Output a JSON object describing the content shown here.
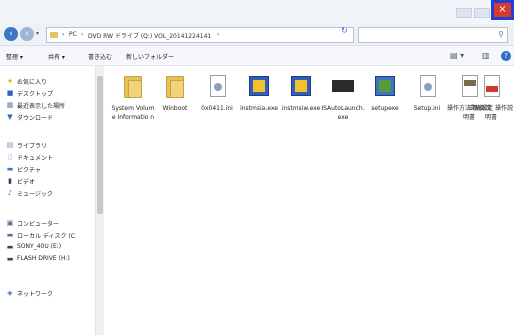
{
  "address": {
    "segments": [
      "PC",
      "DVD RW ドライブ (Q:) VOL_20141224141",
      ""
    ],
    "dropdown_arrow": "▾",
    "refresh": "↻"
  },
  "search": {
    "placeholder": ""
  },
  "toolbar": {
    "organize": "整理 ▾",
    "share": "共有 ▾",
    "burn": "書き込む",
    "new_folder": "新しいフォルダー"
  },
  "sidebar": {
    "items": [
      {
        "label": "お気に入り",
        "icon": "star-icon"
      },
      {
        "label": "デスクトップ",
        "icon": "desktop-icon"
      },
      {
        "label": "最近表示した場所",
        "icon": "recent-places-icon"
      },
      {
        "label": "ダウンロード",
        "icon": "download-icon"
      },
      {
        "label": "ライブラリ",
        "icon": "library-icon"
      },
      {
        "label": "ドキュメント",
        "icon": "documents-icon"
      },
      {
        "label": "ピクチャ",
        "icon": "pictures-icon"
      },
      {
        "label": "ビデオ",
        "icon": "videos-icon"
      },
      {
        "label": "ミュージック",
        "icon": "music-icon"
      },
      {
        "label": "コンピューター",
        "icon": "computer-icon"
      },
      {
        "label": "ローカル ディスク (C",
        "icon": "local-disk-icon"
      },
      {
        "label": "SONY_40U (E:)",
        "icon": "usb-drive-icon"
      },
      {
        "label": "FLASH DRIVE (H:)",
        "icon": "flash-drive-icon"
      },
      {
        "label": "ネットワーク",
        "icon": "network-icon"
      }
    ]
  },
  "files": [
    {
      "name": "System Volume Informatio n",
      "type": "folder"
    },
    {
      "name": "Winboot",
      "type": "folder"
    },
    {
      "name": "0x0411.ini",
      "type": "settings"
    },
    {
      "name": "instmsia.exe",
      "type": "installer"
    },
    {
      "name": "instmsiw.exe",
      "type": "installer"
    },
    {
      "name": "ISAutoLaunch.exe",
      "type": "app"
    },
    {
      "name": "setupexe",
      "type": "setup"
    },
    {
      "name": "Setup.ini",
      "type": "settings"
    },
    {
      "name": "操作方法 取扱説明書",
      "type": "doc"
    },
    {
      "name": "環境設定 操作説明書",
      "type": "doc"
    }
  ]
}
